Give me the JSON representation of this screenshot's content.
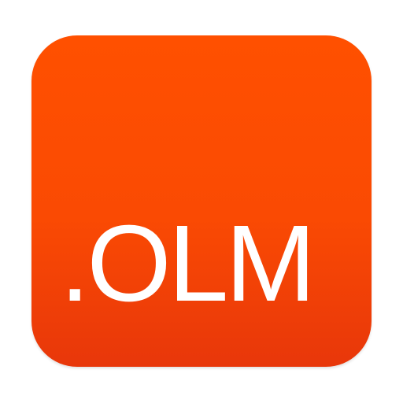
{
  "icon": {
    "text": ".OLM",
    "background_color": "#ff5000",
    "background_color_bottom": "#e8370a",
    "text_color": "#ffffff"
  }
}
